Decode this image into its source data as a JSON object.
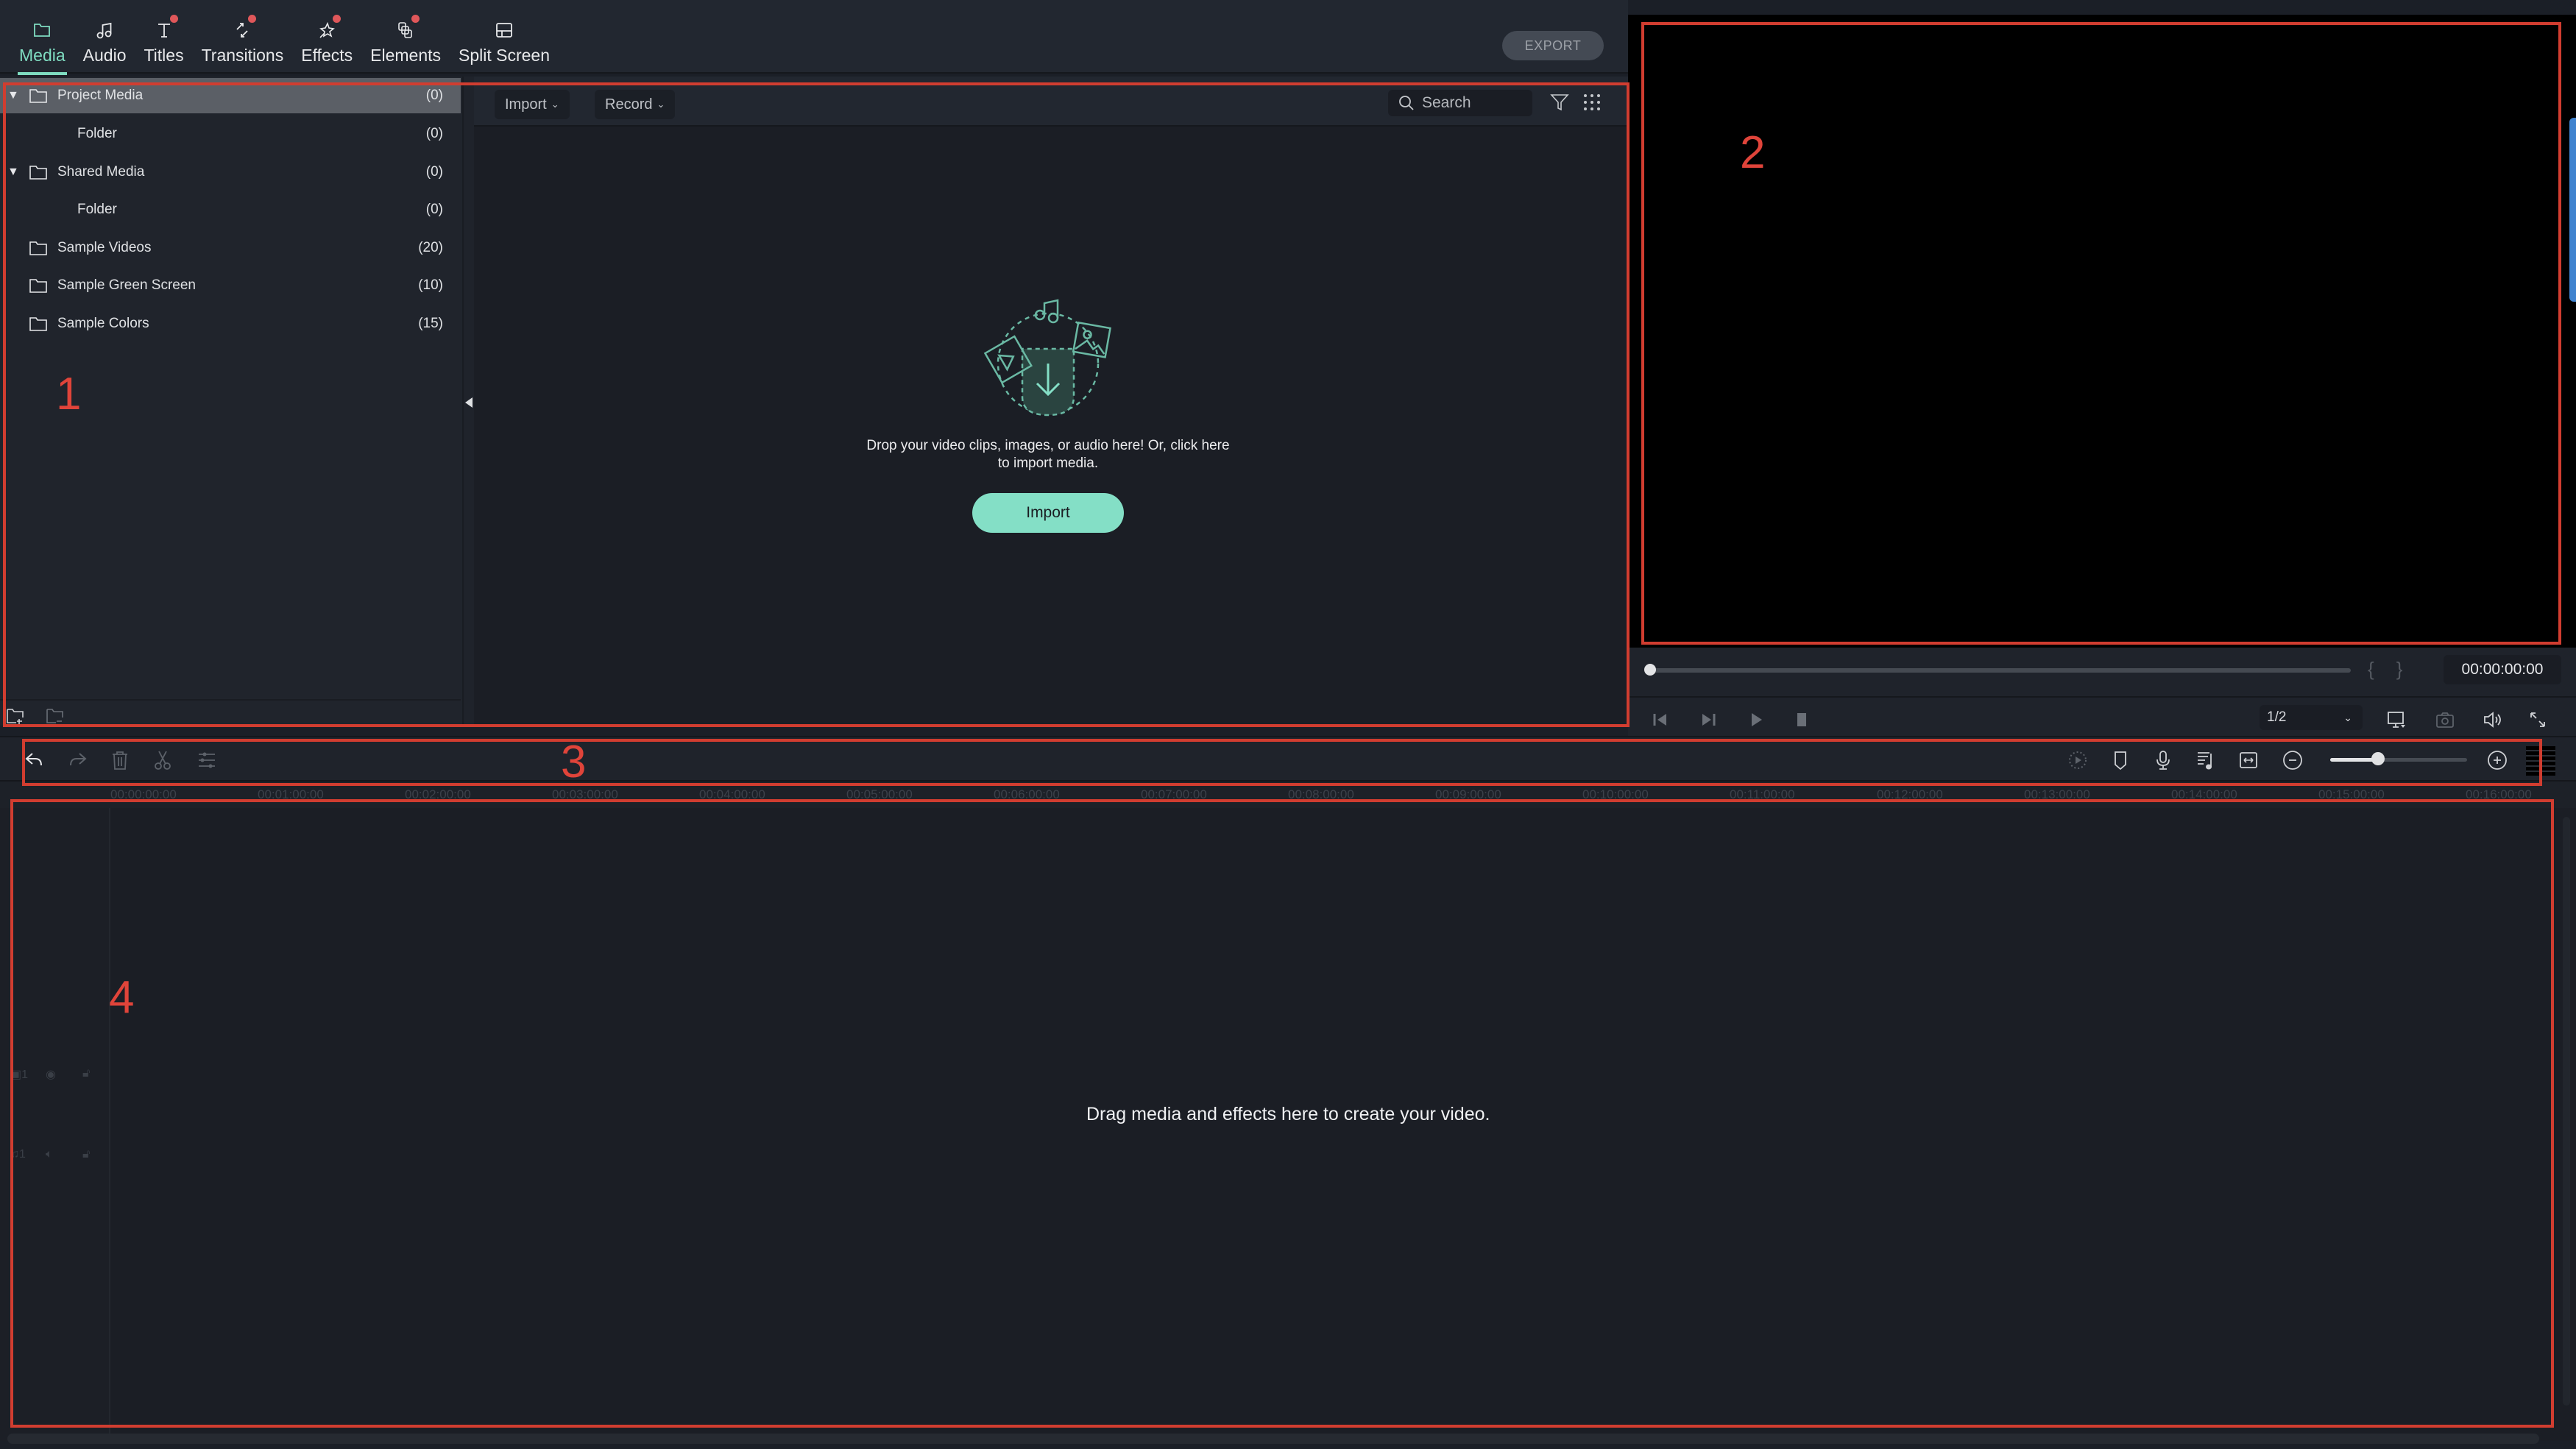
{
  "nav": {
    "tabs": [
      {
        "label": "Media",
        "icon": "folder-icon",
        "active": true,
        "badge": false
      },
      {
        "label": "Audio",
        "icon": "music-note-icon",
        "active": false,
        "badge": false
      },
      {
        "label": "Titles",
        "icon": "text-icon",
        "active": false,
        "badge": true
      },
      {
        "label": "Transitions",
        "icon": "transition-icon",
        "active": false,
        "badge": true
      },
      {
        "label": "Effects",
        "icon": "effects-star-icon",
        "active": false,
        "badge": true
      },
      {
        "label": "Elements",
        "icon": "elements-icon",
        "active": false,
        "badge": true
      },
      {
        "label": "Split Screen",
        "icon": "split-screen-icon",
        "active": false,
        "badge": false
      }
    ],
    "export_label": "EXPORT"
  },
  "library": {
    "items": [
      {
        "name": "Project Media",
        "count": "(0)",
        "expanded": true,
        "selected": true,
        "child": false
      },
      {
        "name": "Folder",
        "count": "(0)",
        "child": true
      },
      {
        "name": "Shared Media",
        "count": "(0)",
        "expanded": true,
        "selected": false,
        "child": false
      },
      {
        "name": "Folder",
        "count": "(0)",
        "child": true
      },
      {
        "name": "Sample Videos",
        "count": "(20)",
        "child": false
      },
      {
        "name": "Sample Green Screen",
        "count": "(10)",
        "child": false
      },
      {
        "name": "Sample Colors",
        "count": "(15)",
        "child": false
      }
    ],
    "footer_icons": [
      "new-folder-icon",
      "delete-folder-icon"
    ]
  },
  "media": {
    "import_dropdown": "Import",
    "record_dropdown": "Record",
    "search_placeholder": "Search",
    "drop_text": "Drop your video clips, images, or audio here! Or, click here to import media.",
    "import_button": "Import"
  },
  "preview": {
    "timecode": "00:00:00:00",
    "playback_progress": 0,
    "resolution": "1/2",
    "mark_in": "{",
    "mark_out": "}"
  },
  "timeline": {
    "toolbar_left": [
      "undo-icon",
      "redo-icon",
      "delete-icon",
      "cut-icon",
      "adjust-icon"
    ],
    "toolbar_right": [
      "render-preview-icon",
      "marker-icon",
      "microphone-icon",
      "audio-mixer-icon",
      "fit-timeline-icon",
      "zoom-out-icon",
      "zoom-in-icon"
    ],
    "zoom_level": 0.35,
    "ruler": [
      "00:00:00:00",
      "00:01:00:00",
      "00:02:00:00",
      "00:03:00:00",
      "00:04:00:00",
      "00:05:00:00",
      "00:06:00:00",
      "00:07:00:00",
      "00:08:00:00",
      "00:09:00:00",
      "00:10:00:00",
      "00:11:00:00",
      "00:12:00:00",
      "00:13:00:00",
      "00:14:00:00",
      "00:15:00:00",
      "00:16:00:00"
    ],
    "video_track_label": "1",
    "audio_track_label": "1",
    "empty_text": "Drag media and effects here to create your video."
  },
  "annotations": [
    "1",
    "2",
    "3",
    "4"
  ],
  "colors": {
    "accent": "#7fdcc1",
    "import_button": "#84dfc6",
    "badge": "#e0575a",
    "annotation": "#d13d30",
    "preview_handle": "#3f83cf"
  }
}
